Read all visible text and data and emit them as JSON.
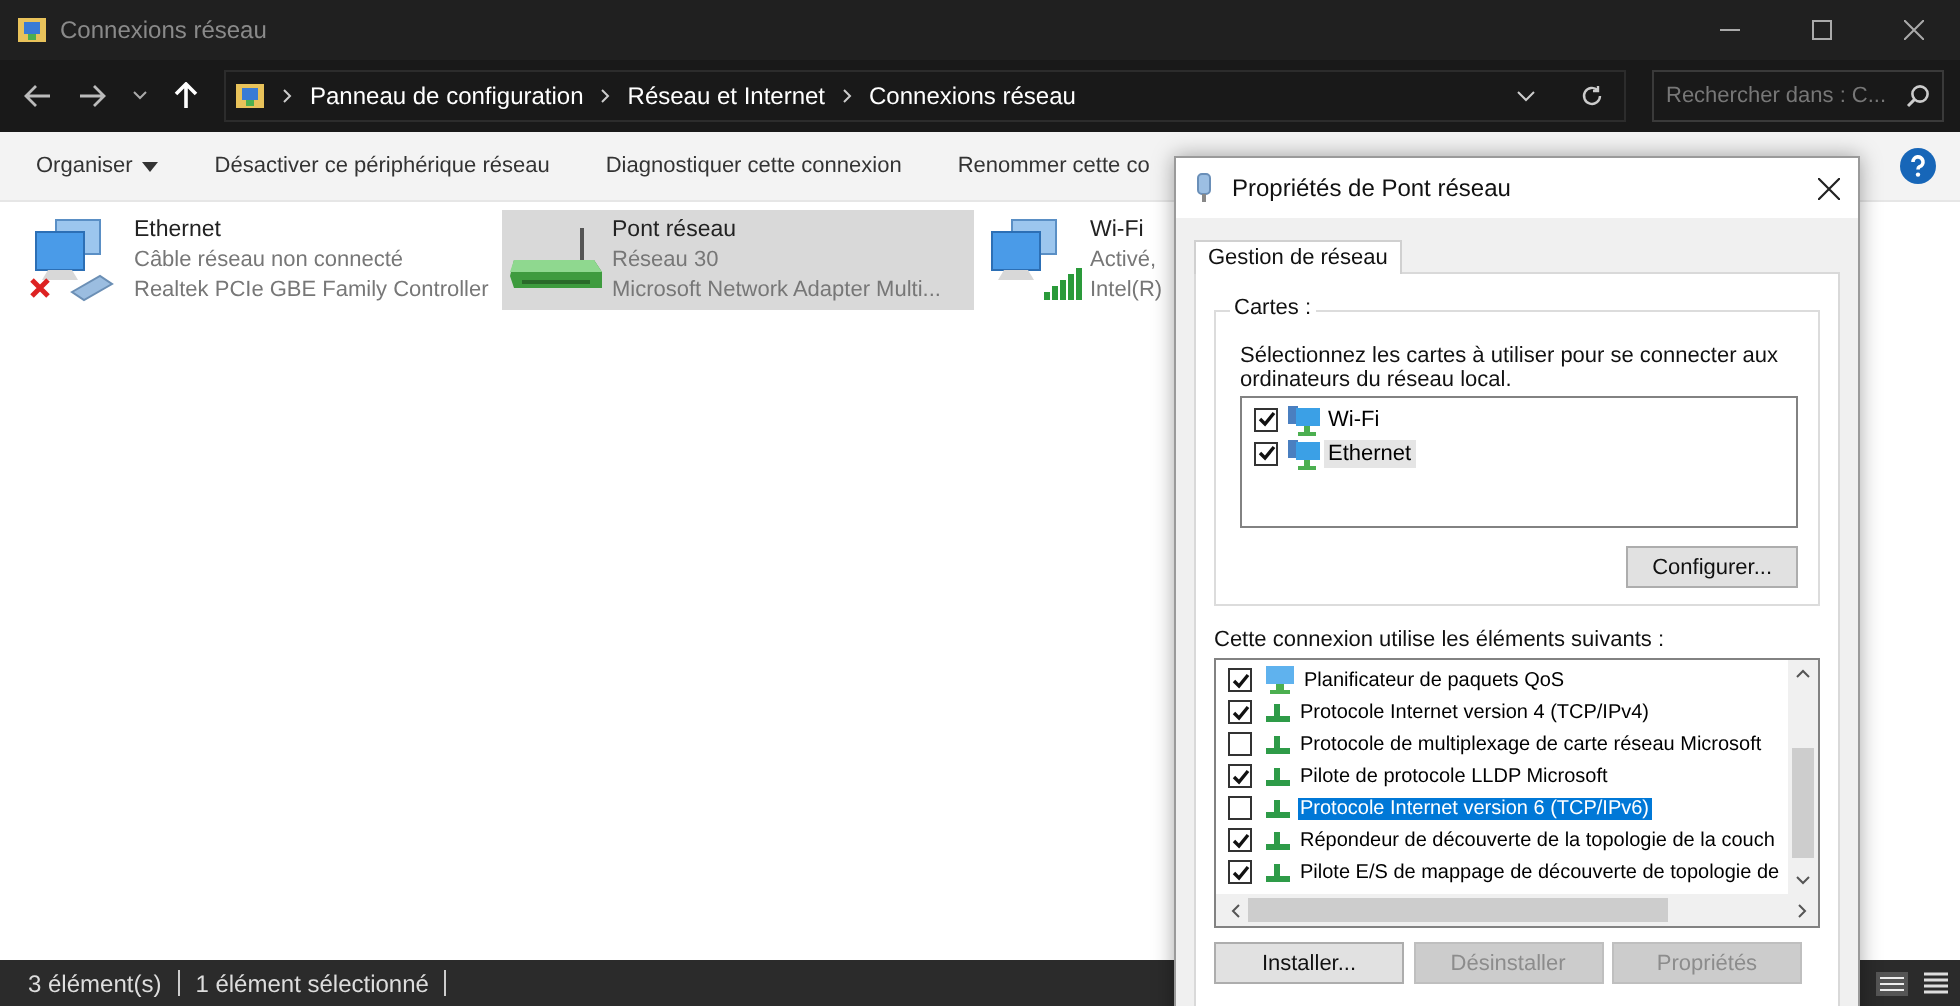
{
  "window": {
    "title": "Connexions réseau"
  },
  "address": {
    "breadcrumbs": [
      "Panneau de configuration",
      "Réseau et Internet",
      "Connexions réseau"
    ],
    "search": {
      "placeholder": "Rechercher dans : C..."
    }
  },
  "commands": [
    {
      "label": "Organiser",
      "dropdown": true
    },
    {
      "label": "Désactiver ce périphérique réseau",
      "dropdown": false
    },
    {
      "label": "Diagnostiquer cette connexion",
      "dropdown": false
    },
    {
      "label": "Renommer cette co",
      "dropdown": false
    }
  ],
  "connections": [
    {
      "kind": "ethernet",
      "name": "Ethernet",
      "status": "Câble réseau non connecté",
      "device": "Realtek PCIe GBE Family Controller",
      "selected": false,
      "disconnected": true
    },
    {
      "kind": "bridge",
      "name": "Pont réseau",
      "status": "Réseau 30",
      "device": "Microsoft Network Adapter Multi...",
      "selected": true,
      "disconnected": false
    },
    {
      "kind": "wifi",
      "name": "Wi-Fi",
      "status": "Activé,",
      "device": "Intel(R)",
      "selected": false,
      "disconnected": false
    }
  ],
  "status_bar": [
    "3 élément(s)",
    "1 élément sélectionné"
  ],
  "dialog": {
    "title": "Propriétés de Pont réseau",
    "tabs": [
      {
        "label": "Gestion de réseau",
        "selected": true
      }
    ],
    "group_title": "Cartes :",
    "instruction": "Sélectionnez les cartes à utiliser pour se connecter aux ordinateurs du réseau local.",
    "adapters": [
      {
        "name": "Wi-Fi",
        "checked": true,
        "selected": false
      },
      {
        "name": "Ethernet",
        "checked": true,
        "selected": true
      }
    ],
    "configure_button": "Configurer...",
    "components_label": "Cette connexion utilise les éléments suivants :",
    "components": [
      {
        "kind": "service",
        "name": "Planificateur de paquets QoS",
        "checked": true,
        "selected": false
      },
      {
        "kind": "protocol",
        "name": "Protocole Internet version 4 (TCP/IPv4)",
        "checked": true,
        "selected": false
      },
      {
        "kind": "protocol",
        "name": "Protocole de multiplexage de carte réseau Microsoft",
        "checked": false,
        "selected": false
      },
      {
        "kind": "protocol",
        "name": "Pilote de protocole LLDP Microsoft",
        "checked": true,
        "selected": false
      },
      {
        "kind": "protocol",
        "name": "Protocole Internet version 6 (TCP/IPv6)",
        "checked": false,
        "selected": true
      },
      {
        "kind": "protocol",
        "name": "Répondeur de découverte de la topologie de la couch",
        "checked": true,
        "selected": false
      },
      {
        "kind": "protocol",
        "name": "Pilote E/S de mappage de découverte de topologie de",
        "checked": true,
        "selected": false
      }
    ],
    "buttons": [
      {
        "label": "Installer...",
        "disabled": false
      },
      {
        "label": "Désinstaller",
        "disabled": true
      },
      {
        "label": "Propriétés",
        "disabled": true
      }
    ]
  }
}
